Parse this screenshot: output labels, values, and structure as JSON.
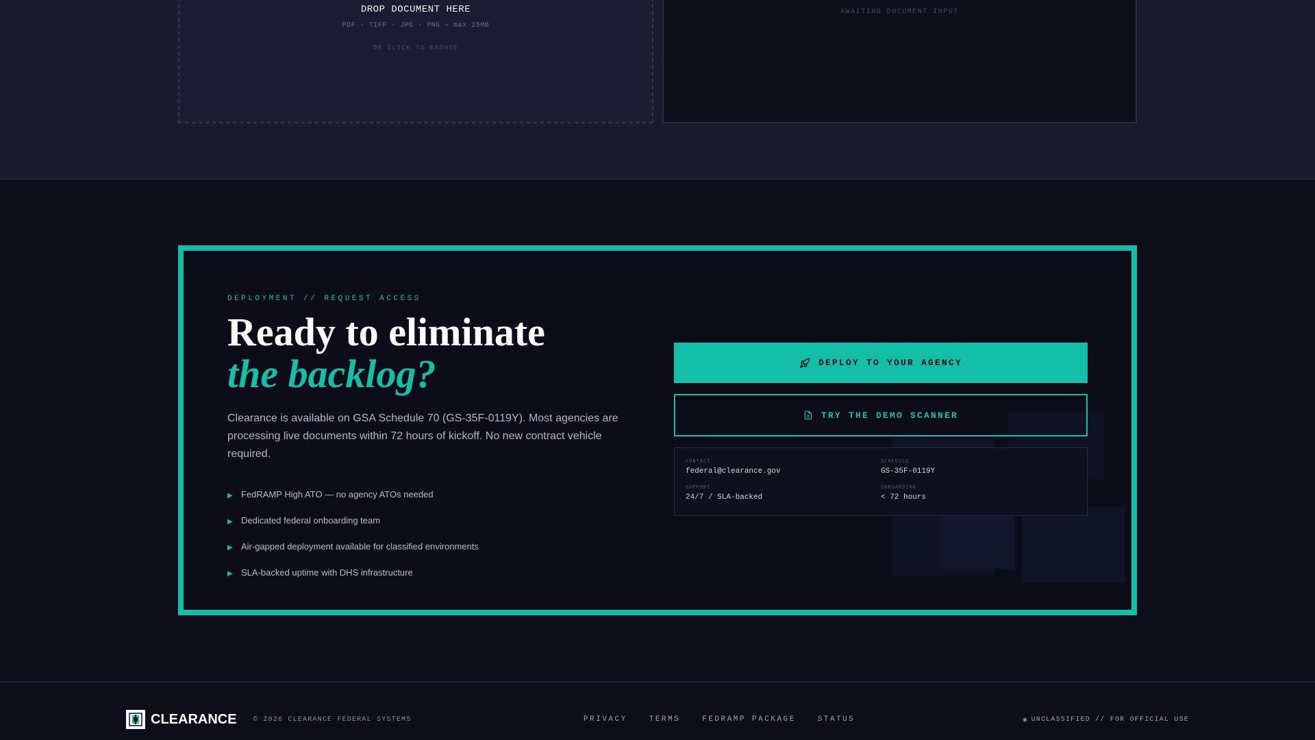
{
  "scanner": {
    "drop_title": "DROP DOCUMENT HERE",
    "drop_formats": "PDF · TIFF · JPG · PNG — max 25MB",
    "drop_browse": "OR CLICK TO BROWSE",
    "output_status": "AWAITING DOCUMENT INPUT"
  },
  "cta": {
    "eyebrow": "DEPLOYMENT // REQUEST ACCESS",
    "headline_line1": "Ready to eliminate",
    "headline_line2": "the backlog?",
    "lead": "Clearance is available on GSA Schedule 70 (GS-35F-0119Y). Most agencies are processing live documents within 72 hours of kickoff. No new contract vehicle required.",
    "bullets": [
      "FedRAMP High ATO — no agency ATOs needed",
      "Dedicated federal onboarding team",
      "Air-gapped deployment available for classified environments",
      "SLA-backed uptime with DHS infrastructure"
    ],
    "primary_button": "DEPLOY TO YOUR AGENCY",
    "secondary_button": "TRY THE DEMO SCANNER",
    "info": {
      "contact_label": "CONTACT",
      "contact_value": "federal@clearance.gov",
      "schedule_label": "SCHEDULE",
      "schedule_value": "GS-35F-0119Y",
      "support_label": "SUPPORT",
      "support_value": "24/7 / SLA-backed",
      "onboarding_label": "ONBOARDING",
      "onboarding_value": "< 72 hours"
    }
  },
  "footer": {
    "logo_text": "CLEARANCE",
    "copyright": "© 2026 CLEARANCE FEDERAL SYSTEMS",
    "links": [
      "PRIVACY",
      "TERMS",
      "FEDRAMP PACKAGE",
      "STATUS"
    ],
    "classification": "UNCLASSIFIED // FOR OFFICIAL USE"
  },
  "colors": {
    "accent": "#13bfa6",
    "background": "#0e0e1b",
    "panel": "#191a2e"
  }
}
